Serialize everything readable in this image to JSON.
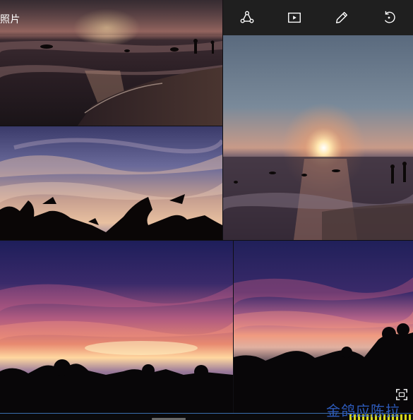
{
  "header": {
    "title": "照片"
  },
  "toolbar": {
    "buttons": [
      {
        "icon": "share-icon"
      },
      {
        "icon": "slideshow-icon"
      },
      {
        "icon": "edit-pencil-icon"
      },
      {
        "icon": "rotate-icon"
      }
    ],
    "icon_color": "#ffffff",
    "background": "#1f1f1f"
  },
  "gallery": {
    "photos": [
      {
        "subject": "beach-sunset-waves-people"
      },
      {
        "subject": "sky-sunset-silhouette-plants"
      },
      {
        "subject": "sea-sun-setting-swimmers"
      },
      {
        "subject": "twilight-sky-treeline"
      },
      {
        "subject": "twilight-clouds-treeline"
      }
    ]
  },
  "fullscreen": {
    "icon": "fullscreen-icon"
  },
  "watermark": {
    "text": "金鸽应陈拉"
  },
  "colors": {
    "accent_line": "#3b6fb0",
    "watermark": "#2f5fc4"
  }
}
